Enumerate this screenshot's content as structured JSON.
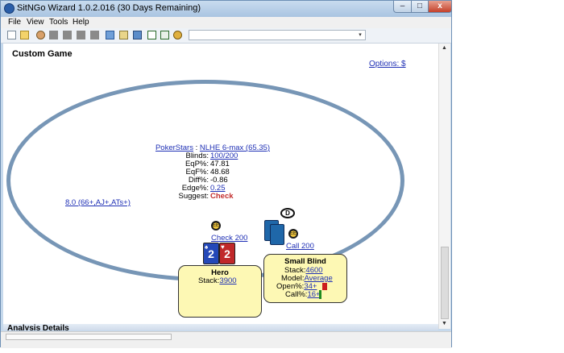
{
  "window": {
    "title": "SitNGo Wizard 1.0.2.016 (30 Days Remaining)",
    "controls": {
      "minimize": "–",
      "maximize": "□",
      "close": "x"
    }
  },
  "menu": [
    "File",
    "View",
    "Tools",
    "Help"
  ],
  "toolbar": {
    "combo_value": "",
    "combo_arrow": "▾"
  },
  "page": {
    "title": "Custom Game",
    "options_link": "Options: $"
  },
  "stats": {
    "site": "PokerStars",
    "separator": " : ",
    "game": "NLHE 6-max (65.35)",
    "blinds_label": "Blinds:",
    "blinds": "100/200",
    "eqp_label": "EqP%:",
    "eqp": "47.81",
    "eqf_label": "EqF%:",
    "eqf": "48.68",
    "diff_label": "Diff%:",
    "diff": "-0.86",
    "edge_label": "Edge%:",
    "edge": "0.25",
    "suggest_label": "Suggest:",
    "suggest": "Check",
    "range": "8.0 (66+,AJ+,ATs+)"
  },
  "actions": {
    "hero": "Check 200",
    "small_blind": "Call 200",
    "chip_label": "EE",
    "dealer": "D"
  },
  "hero": {
    "name": "Hero",
    "stack_label": "Stack:",
    "stack": "3900",
    "cards": [
      {
        "rank": "2",
        "suit": "♠",
        "color": "#2448b8"
      },
      {
        "rank": "2",
        "suit": "♥",
        "color": "#c0282a"
      }
    ]
  },
  "small_blind": {
    "name": "Small Blind",
    "stack_label": "Stack:",
    "stack": "4600",
    "model_label": "Model:",
    "model": "Average",
    "open_label": "Open%:",
    "open": "34+",
    "call_label": "Call%:",
    "call": "16+"
  },
  "panels": {
    "analysis": "Analysis Details"
  },
  "colors": {
    "table_rail": "#7796b6",
    "seat_fill": "#fdf8b4",
    "link": "#1f30b5",
    "suggest": "#c22d2d"
  }
}
